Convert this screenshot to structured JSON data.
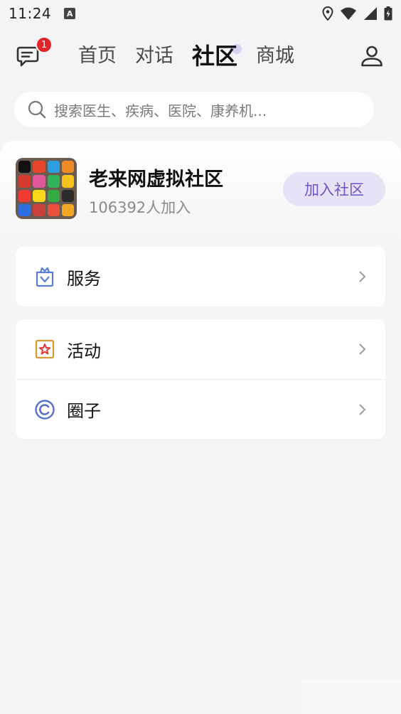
{
  "status_bar": {
    "time": "11:24",
    "notification_letter": "A",
    "icons": [
      "location-icon",
      "wifi-icon",
      "signal-icon",
      "battery-icon"
    ]
  },
  "nav": {
    "chat_badge": "1",
    "tabs": [
      {
        "label": "首页",
        "active": false
      },
      {
        "label": "对话",
        "active": false
      },
      {
        "label": "社区",
        "active": true
      },
      {
        "label": "商城",
        "active": false
      }
    ]
  },
  "search": {
    "placeholder": "搜索医生、疾病、医院、康养机..."
  },
  "community": {
    "title": "老来网虚拟社区",
    "members": "106392人加入",
    "join_label": "加入社区"
  },
  "menu": {
    "service": {
      "label": "服务",
      "icon": "service-box-icon"
    },
    "activity": {
      "label": "活动",
      "icon": "star-badge-icon"
    },
    "circle": {
      "label": "圈子",
      "icon": "circle-ring-icon"
    }
  },
  "colors": {
    "accent": "#6b55c3",
    "accent_bg": "#e7e2f6",
    "badge": "#e2232a",
    "background": "#f4f4f6"
  }
}
